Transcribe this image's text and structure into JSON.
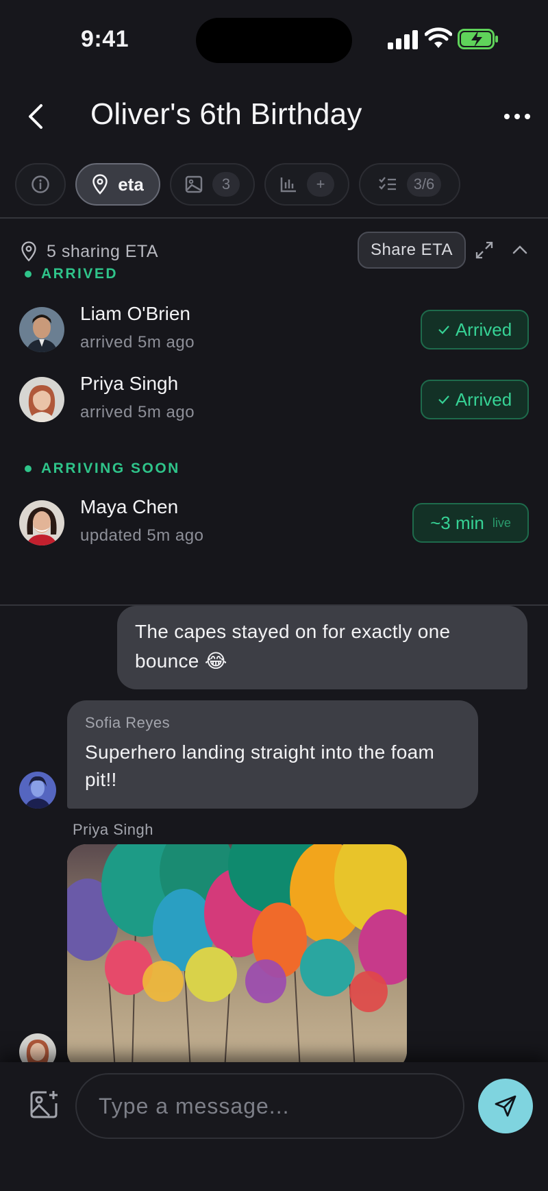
{
  "status_bar": {
    "time": "9:41"
  },
  "header": {
    "title": "Oliver's 6th Birthday"
  },
  "tabs": [
    {
      "id": "info",
      "icon": "info-icon"
    },
    {
      "id": "eta",
      "icon": "location-pin-icon",
      "label": "eta",
      "active": true
    },
    {
      "id": "photos",
      "icon": "image-icon",
      "count": "3"
    },
    {
      "id": "polls",
      "icon": "bar-chart-icon",
      "count": "+"
    },
    {
      "id": "tasks",
      "icon": "checklist-icon",
      "count": "3/6"
    }
  ],
  "eta": {
    "summary": "5 sharing ETA",
    "share_button": "Share ETA",
    "sections": [
      {
        "label": "ARRIVED",
        "people": [
          {
            "name": "Liam O'Brien",
            "status": "arrived 5m ago",
            "badge": "Arrived"
          },
          {
            "name": "Priya Singh",
            "status": "arrived 5m ago",
            "badge": "Arrived"
          }
        ]
      },
      {
        "label": "ARRIVING SOON",
        "people": [
          {
            "name": "Maya Chen",
            "status": "updated 5m ago",
            "badge": "~3 min",
            "badge_tag": "live"
          }
        ]
      }
    ]
  },
  "chat": {
    "messages": [
      {
        "type": "outgoing",
        "text": "The capes stayed on for exactly one bounce 😂"
      },
      {
        "type": "incoming",
        "sender": "Sofia Reyes",
        "text": "Superhero landing straight into the foam pit!!"
      },
      {
        "type": "incoming-photo",
        "sender": "Priya Singh"
      }
    ]
  },
  "composer": {
    "placeholder": "Type a message..."
  },
  "colors": {
    "accent_green": "#2fc48a",
    "send_button": "#7fd4df",
    "background": "#17171c"
  }
}
